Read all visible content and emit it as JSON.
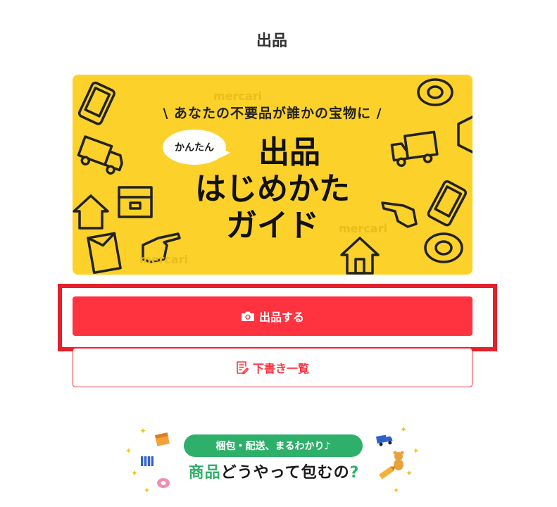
{
  "header": {
    "title": "出品"
  },
  "banner": {
    "tagline": "\\ あなたの不要品が誰かの宝物に /",
    "bubble": "かんたん",
    "line1": "出品",
    "line2": "はじめかた",
    "line3": "ガイド",
    "watermark": "mercari",
    "bg_color": "#fcd12a"
  },
  "actions": {
    "list_label": "出品する",
    "list_icon": "camera-icon",
    "drafts_label": "下書き一覧",
    "drafts_icon": "note-edit-icon",
    "accent": "#ff333f",
    "highlight_color": "#e3202b"
  },
  "guide": {
    "pill": "梱包・配送、まるわかり♪",
    "heading_prefix": "商品",
    "heading_suffix": "どうやって包むの",
    "heading_q": "?",
    "accent": "#2fb06a"
  }
}
